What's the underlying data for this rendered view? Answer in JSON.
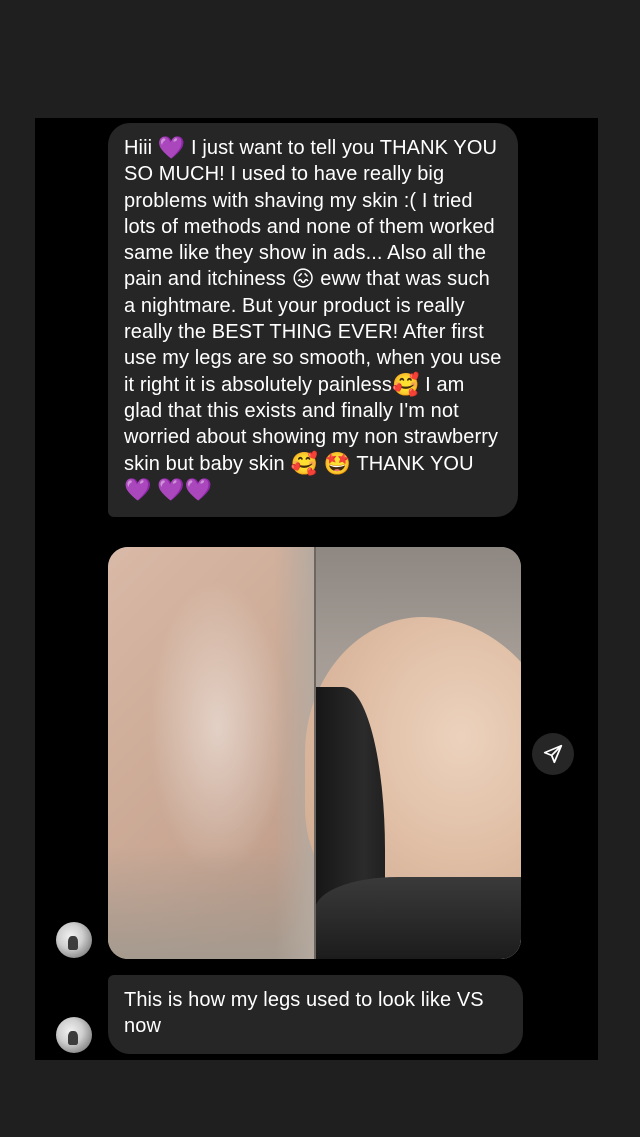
{
  "thread": {
    "messages": [
      {
        "segments": [
          {
            "type": "text",
            "value": "Hiii "
          },
          {
            "type": "emoji",
            "value": "💜"
          },
          {
            "type": "text",
            "value": " I just want to tell you THANK YOU SO MUCH! I used to have really big problems with shaving my skin :( I tried lots of methods and none of them worked same like they show in ads... Also all the pain and itchiness "
          },
          {
            "type": "emoji",
            "value": "😖"
          },
          {
            "type": "text",
            "value": " eww that was such a nightmare. But your product is really really the BEST THING EVER! After first use my legs are so smooth, when you use it right it is absolutely painless"
          },
          {
            "type": "emoji",
            "value": "🥰"
          },
          {
            "type": "text",
            "value": " I am glad that this exists and finally I'm not worried about showing my non strawberry skin but baby skin "
          },
          {
            "type": "emoji",
            "value": "🥰"
          },
          {
            "type": "text",
            "value": " "
          },
          {
            "type": "emoji",
            "value": "🤩"
          },
          {
            "type": "text",
            "value": " THANK YOU "
          },
          {
            "type": "emoji",
            "value": "💜"
          },
          {
            "type": "text",
            "value": " "
          },
          {
            "type": "emoji",
            "value": "💜"
          },
          {
            "type": "emoji",
            "value": "💜"
          }
        ]
      },
      {
        "text": "This is how my legs used to look like VS now"
      }
    ]
  },
  "icons": {
    "share": "paper-plane-icon",
    "avatar": "avatar-image"
  },
  "colors": {
    "page_background": "#1f1f1f",
    "chat_background": "#000000",
    "bubble_background": "#262626",
    "text": "#ffffff"
  }
}
